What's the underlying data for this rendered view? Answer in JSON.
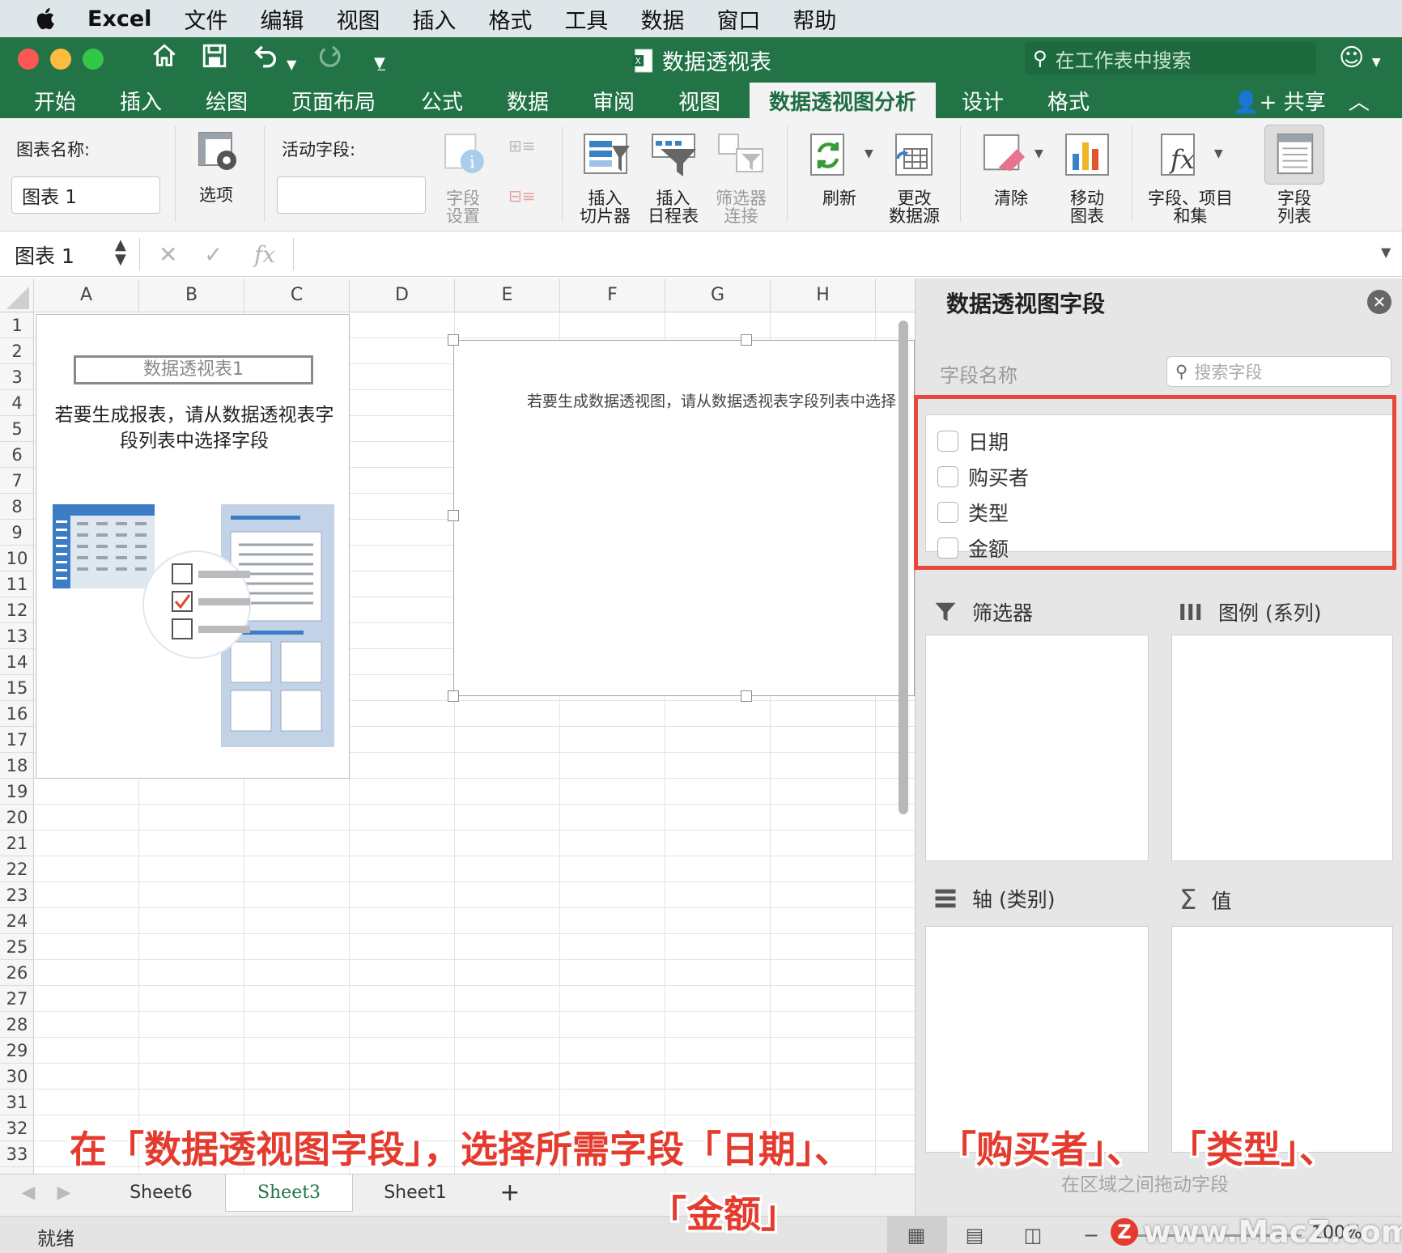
{
  "menubar": {
    "app": "Excel",
    "items": [
      "文件",
      "编辑",
      "视图",
      "插入",
      "格式",
      "工具",
      "数据",
      "窗口",
      "帮助"
    ]
  },
  "titlebar": {
    "document_title": "数据透视表",
    "search_placeholder": "在工作表中搜索"
  },
  "ribbon_tabs": {
    "items": [
      "开始",
      "插入",
      "绘图",
      "页面布局",
      "公式",
      "数据",
      "审阅",
      "视图",
      "数据透视图分析",
      "设计",
      "格式"
    ],
    "active": "数据透视图分析",
    "share_label": "共享"
  },
  "ribbon": {
    "chart_name_label": "图表名称:",
    "chart_name_value": "图表 1",
    "options_label": "选项",
    "active_field_label": "活动字段:",
    "active_field_value": "",
    "field_settings_line1": "字段",
    "field_settings_line2": "设置",
    "insert_slicer_line1": "插入",
    "insert_slicer_line2": "切片器",
    "insert_timeline_line1": "插入",
    "insert_timeline_line2": "日程表",
    "filter_conn_line1": "筛选器",
    "filter_conn_line2": "连接",
    "refresh_label": "刷新",
    "change_source_line1": "更改",
    "change_source_line2": "数据源",
    "clear_label": "清除",
    "move_chart_line1": "移动",
    "move_chart_line2": "图表",
    "fields_items_line1": "字段、项目",
    "fields_items_line2": "和集",
    "field_list_line1": "字段",
    "field_list_line2": "列表"
  },
  "formula_bar": {
    "name_box": "图表 1",
    "fx": "fx"
  },
  "grid": {
    "columns": [
      "A",
      "B",
      "C",
      "D",
      "E",
      "F",
      "G",
      "H"
    ],
    "rows": [
      "1",
      "2",
      "3",
      "4",
      "5",
      "6",
      "7",
      "8",
      "9",
      "10",
      "11",
      "12",
      "13",
      "14",
      "15",
      "16",
      "17",
      "18",
      "19",
      "20",
      "21",
      "22",
      "23",
      "24",
      "25",
      "26",
      "27",
      "28",
      "29",
      "30",
      "31",
      "32",
      "33"
    ],
    "pivot_title": "数据透视表1",
    "pivot_instruction": "若要生成报表，请从数据透视表字段列表中选择字段",
    "chart_message": "若要生成数据透视图，请从数据透视表字段列表中选择"
  },
  "sheet_tabs": {
    "items": [
      "Sheet6",
      "Sheet3",
      "Sheet1"
    ],
    "active": "Sheet3",
    "add_label": "+"
  },
  "pane": {
    "title": "数据透视图字段",
    "field_name_label": "字段名称",
    "search_placeholder": "搜索字段",
    "fields": [
      "日期",
      "购买者",
      "类型",
      "金额"
    ],
    "filters_label": "筛选器",
    "legend_label": "图例 (系列)",
    "axis_label": "轴 (类别)",
    "values_label": "值",
    "drag_hint": "在区域之间拖动字段"
  },
  "status": {
    "text": "就绪",
    "zoom": "100%"
  },
  "caption": {
    "line1_part1": "在「数据透视图字段」，选择所需字段「日期」、",
    "line1_part2": "「购买者」、",
    "line1_part3": "「类型」、",
    "line2": "「金额」"
  },
  "watermark": {
    "z": "Z",
    "text": "www.MacZ.com"
  },
  "colors": {
    "excel_green": "#227446",
    "highlight_red": "#e8473d",
    "caption_red": "#e53b2e"
  }
}
